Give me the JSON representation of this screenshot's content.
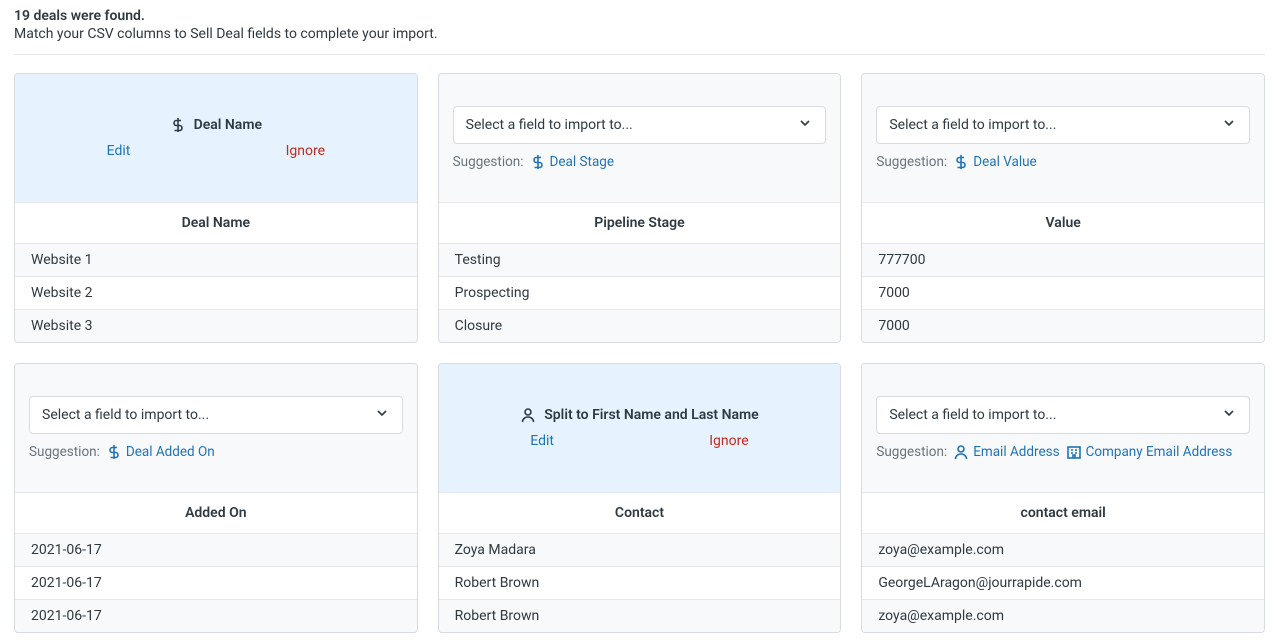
{
  "header": {
    "title": "19 deals were found.",
    "subtitle": "Match your CSV columns to Sell Deal fields to complete your import."
  },
  "common": {
    "select_placeholder": "Select a field to import to...",
    "suggestion_label": "Suggestion:",
    "edit": "Edit",
    "ignore": "Ignore"
  },
  "cards": [
    {
      "mode": "mapped",
      "mapped_icon": "dollar",
      "mapped_label": "Deal Name",
      "column_header": "Deal Name",
      "rows": [
        "Website 1",
        "Website 2",
        "Website 3"
      ]
    },
    {
      "mode": "unmapped",
      "suggestions": [
        {
          "icon": "dollar",
          "label": "Deal Stage"
        }
      ],
      "column_header": "Pipeline Stage",
      "rows": [
        "Testing",
        "Prospecting",
        "Closure"
      ]
    },
    {
      "mode": "unmapped",
      "suggestions": [
        {
          "icon": "dollar",
          "label": "Deal Value"
        }
      ],
      "column_header": "Value",
      "rows": [
        "777700",
        "7000",
        "7000"
      ]
    },
    {
      "mode": "unmapped",
      "suggestions": [
        {
          "icon": "dollar",
          "label": "Deal Added On"
        }
      ],
      "column_header": "Added On",
      "rows": [
        "2021-06-17",
        "2021-06-17",
        "2021-06-17"
      ]
    },
    {
      "mode": "mapped",
      "mapped_icon": "person",
      "mapped_label": "Split to First Name and Last Name",
      "column_header": "Contact",
      "rows": [
        "Zoya Madara",
        "Robert Brown",
        "Robert Brown"
      ]
    },
    {
      "mode": "unmapped",
      "suggestions": [
        {
          "icon": "person",
          "label": "Email Address"
        },
        {
          "icon": "company",
          "label": "Company Email Address"
        }
      ],
      "column_header": "contact email",
      "rows": [
        "zoya@example.com",
        "GeorgeLAragon@jourrapide.com",
        "zoya@example.com"
      ]
    }
  ]
}
